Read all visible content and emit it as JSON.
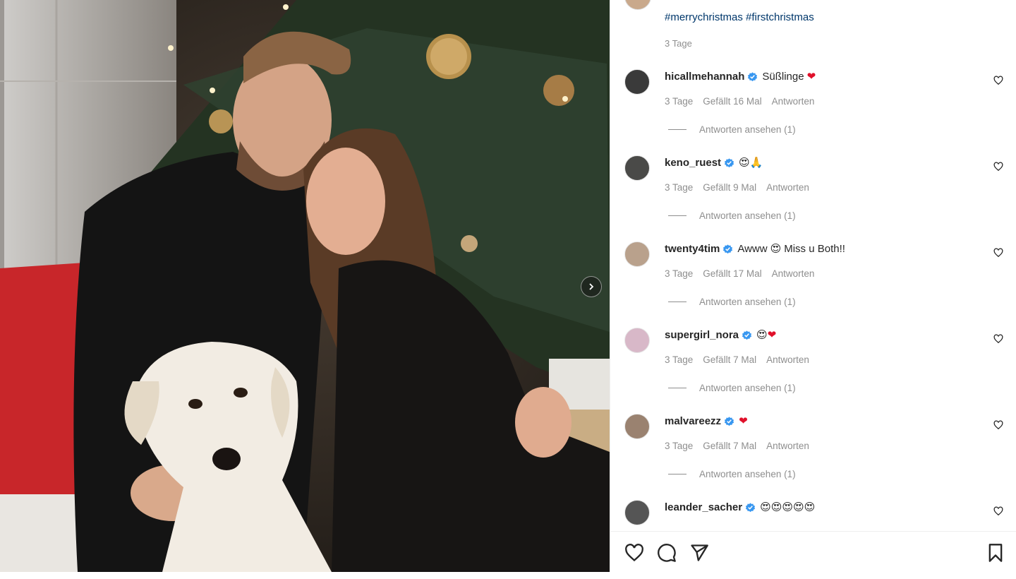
{
  "post": {
    "hashtags": "#merrychristmas #firstchristmas",
    "posted": "3 Tage"
  },
  "comments": [
    {
      "username": "hicallmehannah",
      "text": "Süßlinge",
      "emoji": [
        "❤"
      ],
      "time": "3 Tage",
      "likes": "Gefällt 16 Mal",
      "reply_label": "Antworten",
      "view_replies": "Antworten ansehen (1)",
      "avatar_color": "#3a3a3a"
    },
    {
      "username": "keno_ruest",
      "text": "",
      "emoji": [
        "😍",
        "🙏"
      ],
      "time": "3 Tage",
      "likes": "Gefällt 9 Mal",
      "reply_label": "Antworten",
      "view_replies": "Antworten ansehen (1)",
      "avatar_color": "#4a4a48"
    },
    {
      "username": "twenty4tim",
      "text": "Awww",
      "emoji": [
        "😍"
      ],
      "text_after": "Miss u Both!!",
      "time": "3 Tage",
      "likes": "Gefällt 17 Mal",
      "reply_label": "Antworten",
      "view_replies": "Antworten ansehen (1)",
      "avatar_color": "#b9a18c"
    },
    {
      "username": "supergirl_nora",
      "text": "",
      "emoji": [
        "😍",
        "❤"
      ],
      "time": "3 Tage",
      "likes": "Gefällt 7 Mal",
      "reply_label": "Antworten",
      "view_replies": "Antworten ansehen (1)",
      "avatar_color": "#d8b8c8"
    },
    {
      "username": "malvareezz",
      "text": "",
      "emoji": [
        "❤"
      ],
      "time": "3 Tage",
      "likes": "Gefällt 7 Mal",
      "reply_label": "Antworten",
      "view_replies": "Antworten ansehen (1)",
      "avatar_color": "#9a8270"
    },
    {
      "username": "leander_sacher",
      "text": "",
      "emoji": [
        "😍",
        "😍",
        "😍",
        "😍",
        "😍"
      ],
      "avatar_color": "#555555"
    }
  ],
  "actions": {
    "like_icon": "heart-outline-icon",
    "comment_icon": "speech-bubble-icon",
    "share_icon": "paper-plane-icon",
    "save_icon": "bookmark-icon"
  },
  "colors": {
    "link": "#00376b",
    "verified": "#3897f0",
    "meta": "#8e8e8e",
    "heart_emoji": "#e0102a"
  }
}
